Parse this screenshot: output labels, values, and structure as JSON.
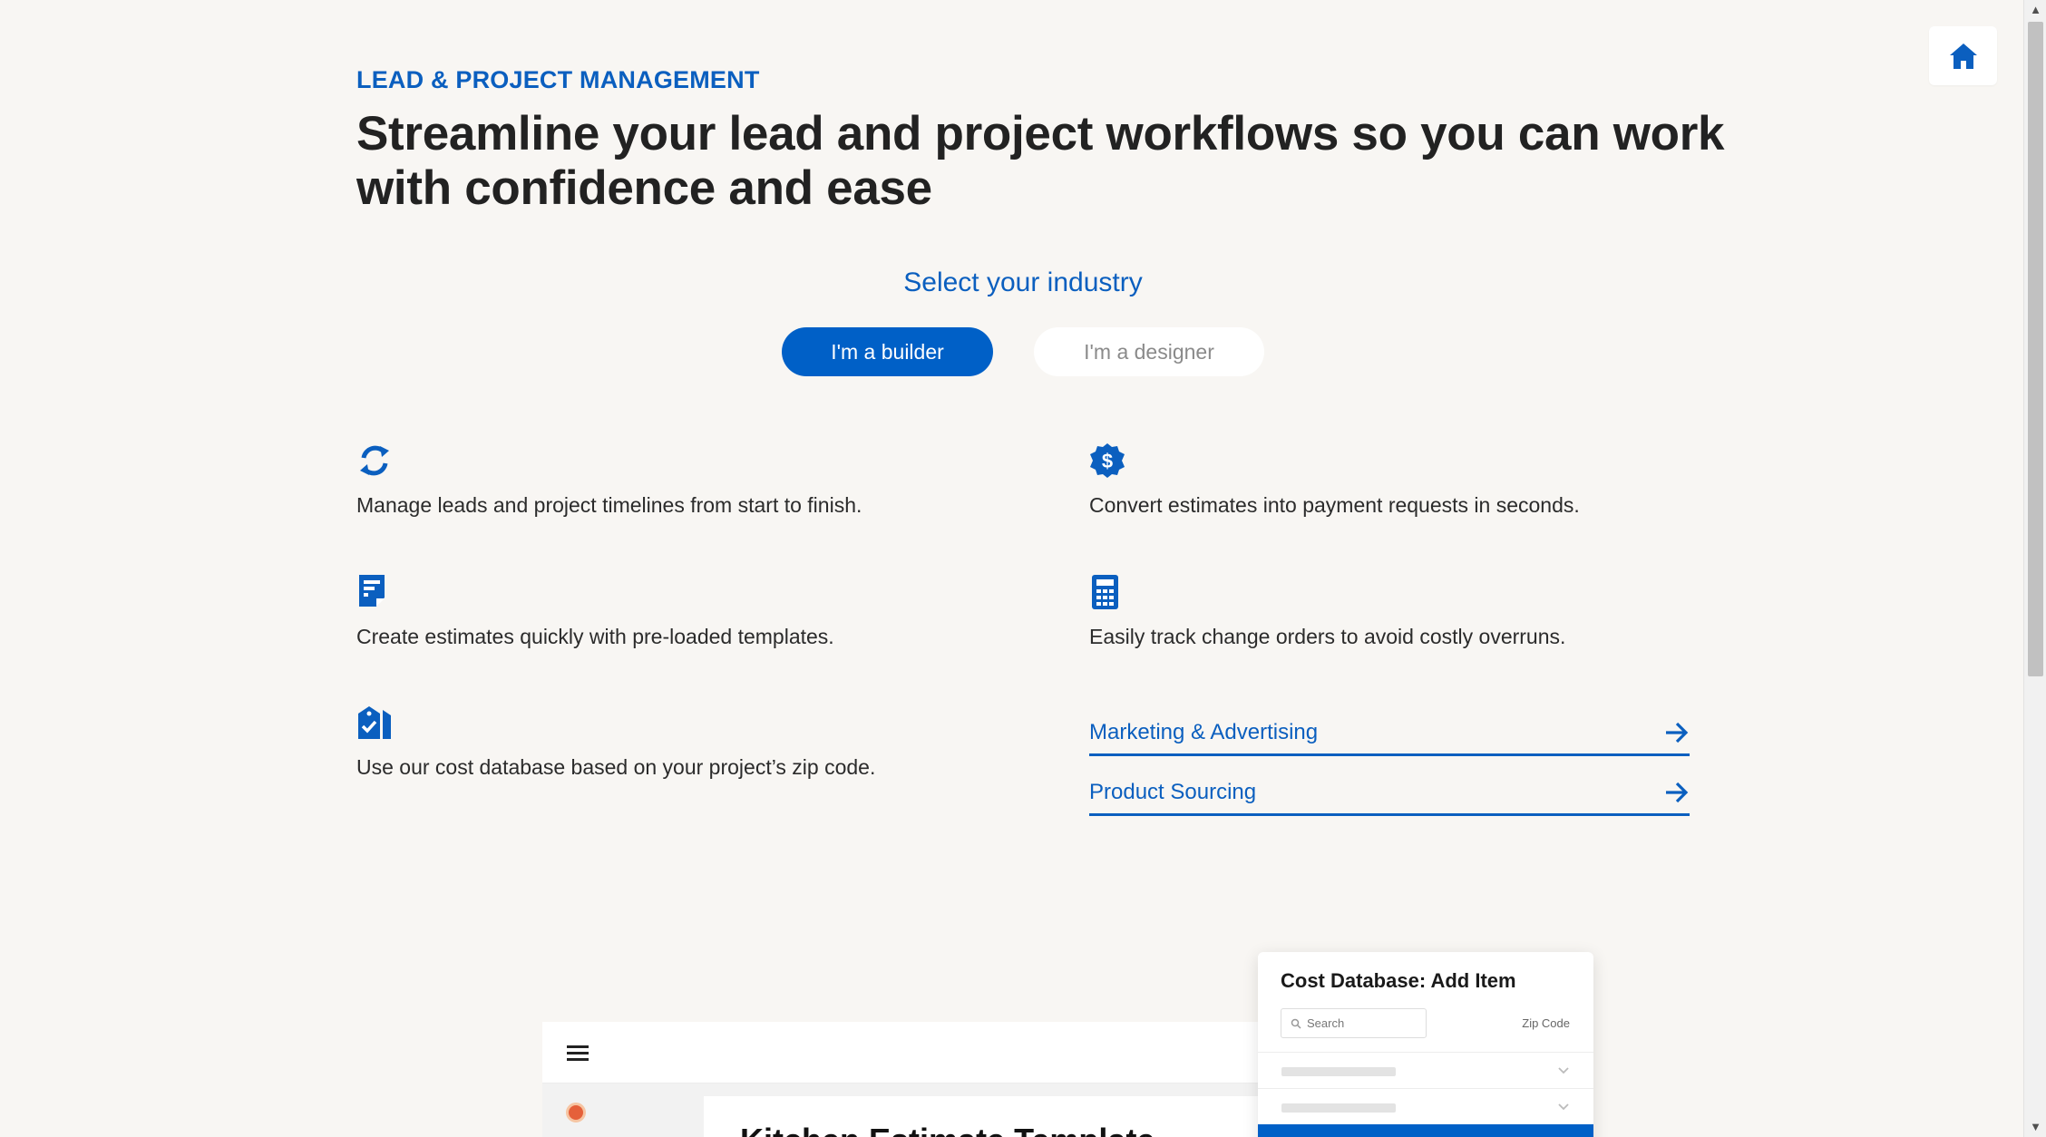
{
  "header": {
    "eyebrow": "LEAD & PROJECT MANAGEMENT",
    "headline": "Streamline your lead and project workflows so you can work with confidence and ease"
  },
  "industry": {
    "label": "Select your industry",
    "options": [
      {
        "label": "I'm a builder",
        "selected": true
      },
      {
        "label": "I'm a designer",
        "selected": false
      }
    ]
  },
  "features": [
    {
      "icon": "refresh-icon",
      "text": "Manage leads and project timelines from start to finish."
    },
    {
      "icon": "dollar-badge-icon",
      "text": "Convert estimates into payment requests in seconds."
    },
    {
      "icon": "document-icon",
      "text": "Create estimates quickly with pre-loaded templates."
    },
    {
      "icon": "calculator-icon",
      "text": "Easily track change orders to avoid costly overruns."
    },
    {
      "icon": "location-tag-icon",
      "text": "Use our cost database based on your project’s zip code."
    }
  ],
  "links": [
    {
      "label": "Marketing & Advertising"
    },
    {
      "label": "Product Sourcing"
    }
  ],
  "preview": {
    "doc_title": "Kitchen Estimate Template",
    "modal": {
      "title": "Cost Database: Add Item",
      "search_placeholder": "Search",
      "zip_label": "Zip Code"
    }
  },
  "colors": {
    "accent": "#0b5fbf",
    "button_primary": "#0060c7",
    "background": "#f8f6f3"
  }
}
